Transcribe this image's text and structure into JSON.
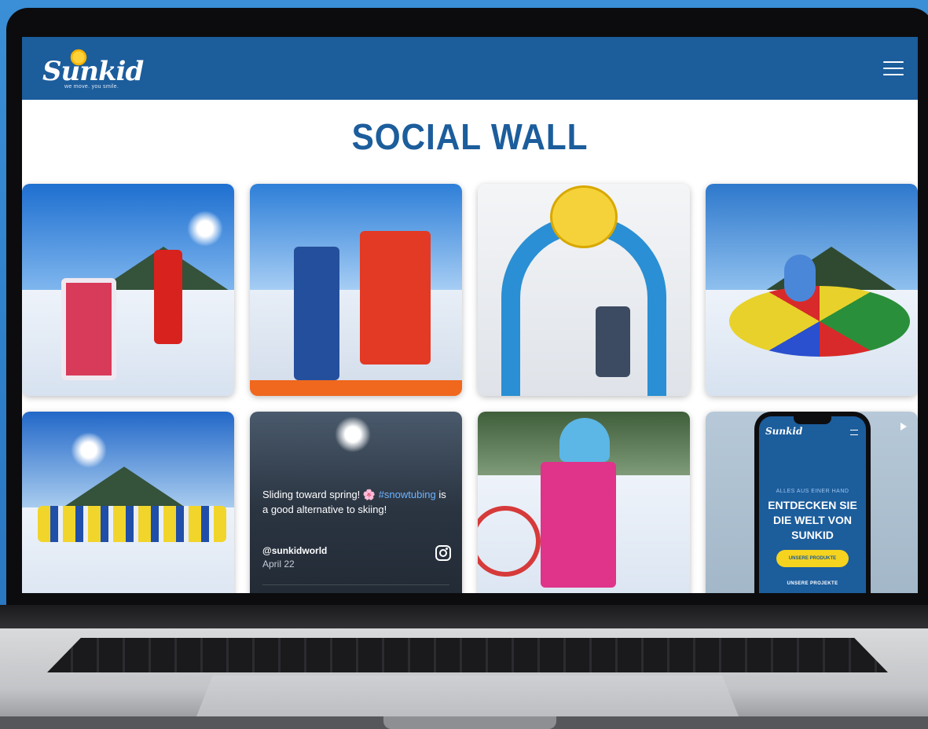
{
  "header": {
    "logo_text": "Sunkid",
    "logo_tagline": "we move. you smile."
  },
  "page": {
    "title": "SOCIAL WALL"
  },
  "post": {
    "text_before": "Sliding toward spring! 🌸 ",
    "hashtag": "#snowtubing",
    "text_after": " is a good alternative to skiing!",
    "handle": "@sunkidworld",
    "date": "April 22"
  },
  "phone": {
    "logo": "Sunkid",
    "kicker": "ALLES AUS EINER HAND",
    "headline": "ENTDECKEN SIE DIE WELT VON SUNKID",
    "button": "UNSERE PRODUKTE",
    "link": "UNSERE PROJEKTE"
  },
  "colors": {
    "brand_blue": "#1c5d9c",
    "background_blue": "#2c7cc8",
    "button_yellow": "#f5d31f"
  },
  "icons": {
    "menu": "hamburger-menu-icon",
    "social": "instagram-icon",
    "video": "play-icon"
  }
}
